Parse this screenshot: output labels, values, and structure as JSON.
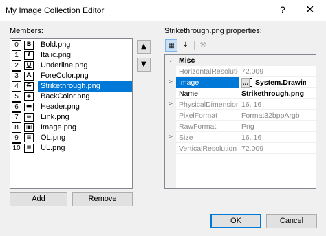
{
  "window": {
    "title": "My Image Collection Editor",
    "help_icon": "?",
    "close_icon": "✕"
  },
  "members": {
    "label": "Members:",
    "items": [
      {
        "index": "0",
        "icon": "B",
        "name": "Bold.png"
      },
      {
        "index": "1",
        "icon": "I",
        "name": "Italic.png"
      },
      {
        "index": "2",
        "icon": "U",
        "name": "Underline.png"
      },
      {
        "index": "3",
        "icon": "A",
        "name": "ForeColor.png"
      },
      {
        "index": "4",
        "icon": "S",
        "name": "Strikethrough.png"
      },
      {
        "index": "5",
        "icon": "◈",
        "name": "BackColor.png"
      },
      {
        "index": "6",
        "icon": "▬",
        "name": "Header.png"
      },
      {
        "index": "7",
        "icon": "∞",
        "name": "Link.png"
      },
      {
        "index": "8",
        "icon": "▣",
        "name": "Image.png"
      },
      {
        "index": "9",
        "icon": "≡",
        "name": "OL.png"
      },
      {
        "index": "10",
        "icon": "≡",
        "name": "UL.png"
      }
    ],
    "selected_index": 4,
    "move_up": "▲",
    "move_down": "▼"
  },
  "buttons": {
    "add": "Add",
    "remove": "Remove",
    "ok": "OK",
    "cancel": "Cancel"
  },
  "properties": {
    "label": "Strikethrough.png properties:",
    "toolbar": {
      "categorized": "categorized-icon",
      "alphabetical": "alphabetical-icon",
      "property_pages": "wrench-icon"
    },
    "category": "Misc",
    "rows": [
      {
        "name": "HorizontalResolution",
        "value": "72.009",
        "style": "gray",
        "expander": ""
      },
      {
        "name": "Image",
        "value": "System.Drawing.Bitmap",
        "style": "sel bold",
        "expander": ">"
      },
      {
        "name": "Name",
        "value": "Strikethrough.png",
        "style": "bold",
        "expander": ""
      },
      {
        "name": "PhysicalDimension",
        "value": "16, 16",
        "style": "gray",
        "expander": ">"
      },
      {
        "name": "PixelFormat",
        "value": "Format32bppArgb",
        "style": "gray",
        "expander": ""
      },
      {
        "name": "RawFormat",
        "value": "Png",
        "style": "gray",
        "expander": ""
      },
      {
        "name": "Size",
        "value": "16, 16",
        "style": "gray",
        "expander": ">"
      },
      {
        "name": "VerticalResolution",
        "value": "72.009",
        "style": "gray",
        "expander": ""
      }
    ],
    "image_value_shown": "System.Drawing.",
    "ellipsis": "..."
  }
}
